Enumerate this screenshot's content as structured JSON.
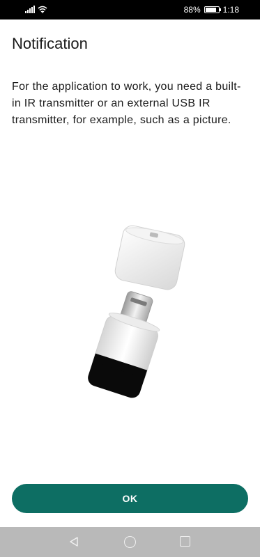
{
  "status_bar": {
    "battery_percent": "88%",
    "time": "1:18",
    "battery_level": 0.88,
    "icons": [
      "signal-icon",
      "wifi-icon",
      "battery-icon"
    ]
  },
  "dialog": {
    "title": "Notification",
    "message": "For the application to work, you need a built-in IR transmitter or an external USB IR transmitter, for example, such as a picture.",
    "ok_label": "OK"
  },
  "colors": {
    "accent": "#0d6e63",
    "nav_bar": "#b9b9b9"
  },
  "nav_bar": {
    "icons": [
      "back-icon",
      "home-icon",
      "recents-icon"
    ]
  }
}
